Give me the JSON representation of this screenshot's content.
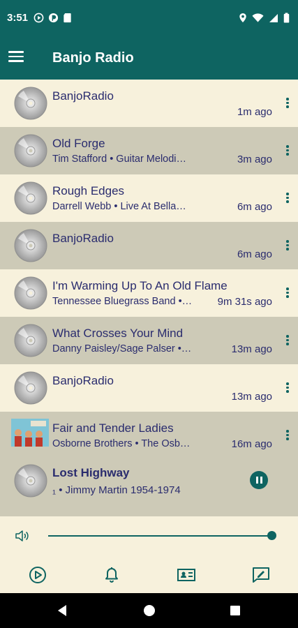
{
  "status_bar": {
    "time": "3:51",
    "left_icons": [
      "play-circle-icon",
      "pocket-casts-icon",
      "sd-card-icon"
    ],
    "right_icons": [
      "location-icon",
      "wifi-icon",
      "signal-icon",
      "battery-icon"
    ]
  },
  "app_bar": {
    "title": "Banjo Radio",
    "menu_icon": "hamburger-menu-icon"
  },
  "history": [
    {
      "title": "BanjoRadio",
      "subtitle": "",
      "time": "1m ago",
      "art": "cd-icon"
    },
    {
      "title": "Old Forge",
      "subtitle": "Tim Stafford • Guitar Melodi…",
      "time": "3m ago",
      "art": "cd-icon"
    },
    {
      "title": "Rough Edges",
      "subtitle": "Darrell Webb • Live At Bella…",
      "time": "6m ago",
      "art": "cd-icon"
    },
    {
      "title": "BanjoRadio",
      "subtitle": "",
      "time": "6m ago",
      "art": "cd-icon"
    },
    {
      "title": "I'm Warming Up To An Old Flame",
      "subtitle": "Tennessee Bluegrass Band •…",
      "time": "9m 31s ago",
      "art": "cd-icon"
    },
    {
      "title": "What Crosses Your Mind",
      "subtitle": "Danny Paisley/Sage Palser •…",
      "time": "13m ago",
      "art": "cd-icon"
    },
    {
      "title": "BanjoRadio",
      "subtitle": "",
      "time": "13m ago",
      "art": "cd-icon"
    },
    {
      "title": "Fair and Tender Ladies",
      "subtitle": "Osborne Brothers • The Osb…",
      "time": "16m ago",
      "art": "album-cover"
    }
  ],
  "now_playing": {
    "title": "Lost Highway",
    "subtitle": "₁ • Jimmy Martin 1954-1974",
    "state_icon": "pause-icon"
  },
  "volume": {
    "level": 1.0,
    "icon": "volume-icon"
  },
  "bottom_tabs": [
    "play-tab-icon",
    "alarm-bell-icon",
    "station-card-icon",
    "feedback-icon"
  ],
  "nav_bar": [
    "back-icon",
    "home-icon",
    "recents-icon"
  ],
  "colors": {
    "primary": "#0e6461",
    "background": "#f7f1dc",
    "alt_row": "#cdcab7",
    "text": "#2a2c6e"
  }
}
